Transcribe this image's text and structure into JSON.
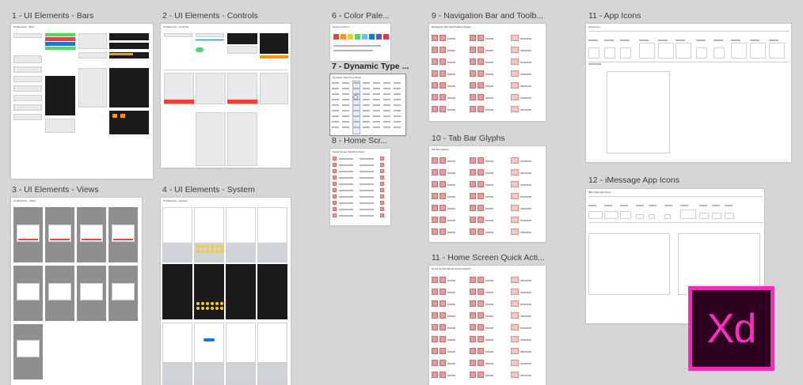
{
  "artboards": [
    {
      "id": "ui-bars",
      "title": "1 - UI Elements - Bars",
      "inner_title": "UI Elements - Bars"
    },
    {
      "id": "ui-controls",
      "title": "2 - UI Elements - Controls",
      "inner_title": "UI Elements - Controls"
    },
    {
      "id": "color-palette",
      "title": "6 - Color Pale...",
      "inner_title": "System Colors"
    },
    {
      "id": "dynamic-type",
      "title": "7 - Dynamic Type ...",
      "inner_title": "Dynamic Type Font Sizes"
    },
    {
      "id": "home-screen",
      "title": "8 - Home Scr...",
      "inner_title": "Home Screen Quick Actions"
    },
    {
      "id": "nav-toolbar",
      "title": "9 - Navigation Bar and Toolb...",
      "inner_title": "Navigation Bar and Toolbar Glyphs"
    },
    {
      "id": "tab-bar",
      "title": "10 - Tab Bar Glyphs",
      "inner_title": "Tab Bar Glyphs"
    },
    {
      "id": "quick-actions",
      "title": "11 - Home Screen Quick Acti...",
      "inner_title": "Home Screen Quick Action Glyphs"
    },
    {
      "id": "app-icons",
      "title": "11 - App Icons",
      "inner_title": "App Icons"
    },
    {
      "id": "imessage-icons",
      "title": "12 - iMessage App Icons",
      "inner_title": "iMessage App Icons"
    },
    {
      "id": "ui-views",
      "title": "3 - UI Elements - Views",
      "inner_title": "UI Elements - Views"
    },
    {
      "id": "ui-system",
      "title": "4 - UI Elements - System",
      "inner_title": "UI Elements - System"
    }
  ],
  "logo": {
    "text": "Xd",
    "border_color": "#ff26be",
    "fill_color": "#2e001f"
  },
  "palette_colors": [
    "#ff3b30",
    "#ff9500",
    "#ffcc00",
    "#4cd964",
    "#5ac8fa",
    "#007aff",
    "#5856d6",
    "#ff2d55"
  ]
}
